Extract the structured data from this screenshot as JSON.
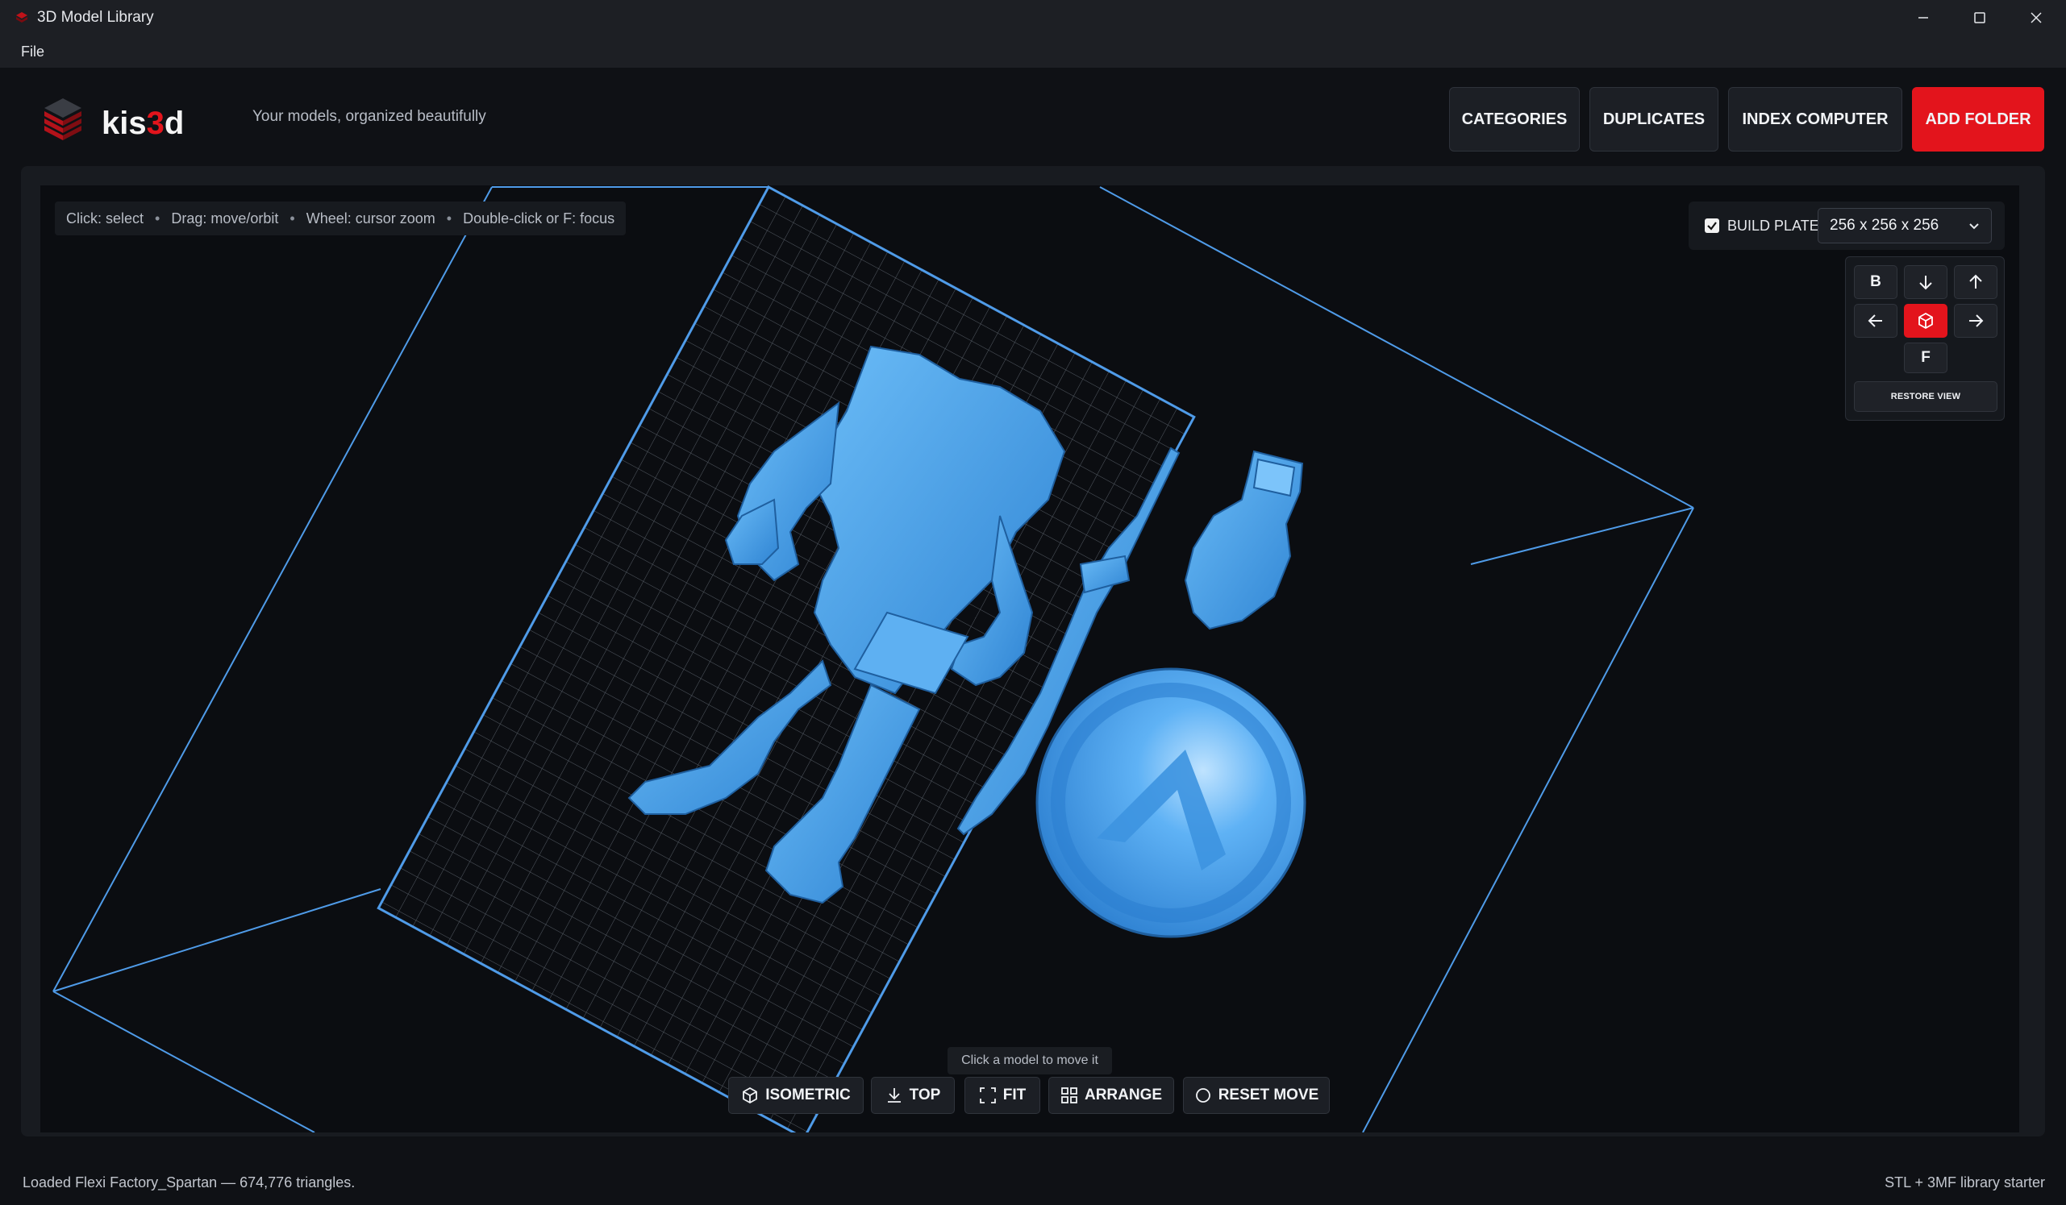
{
  "window": {
    "title": "3D Model Library"
  },
  "menu": {
    "file": "File"
  },
  "header": {
    "logo_text": "kis3d",
    "tagline": "Your models, organized beautifully",
    "buttons": {
      "categories": "CATEGORIES",
      "duplicates": "DUPLICATES",
      "index_computer": "INDEX COMPUTER",
      "add_folder": "ADD FOLDER"
    }
  },
  "viewer": {
    "hint": {
      "select": "Click: select",
      "move": "Drag: move/orbit",
      "zoom": "Wheel: cursor zoom",
      "focus": "Double-click or F: focus"
    },
    "build_plate": {
      "label": "BUILD PLATE",
      "checked": true,
      "size": "256 x 256 x 256"
    },
    "nav": {
      "back": "B",
      "front": "F",
      "restore": "RESTORE VIEW"
    },
    "tooltip": "Click a model to move it",
    "toolbar": {
      "isometric": "ISOMETRIC",
      "top": "TOP",
      "fit": "FIT",
      "arrange": "ARRANGE",
      "reset_move": "RESET MOVE"
    }
  },
  "status": {
    "left": "Loaded Flexi Factory_Spartan — 674,776 triangles.",
    "right": "STL + 3MF library starter"
  },
  "colors": {
    "accent": "#e3141c",
    "model": "#4aa3f0",
    "plate_edge": "#4f9be8"
  }
}
